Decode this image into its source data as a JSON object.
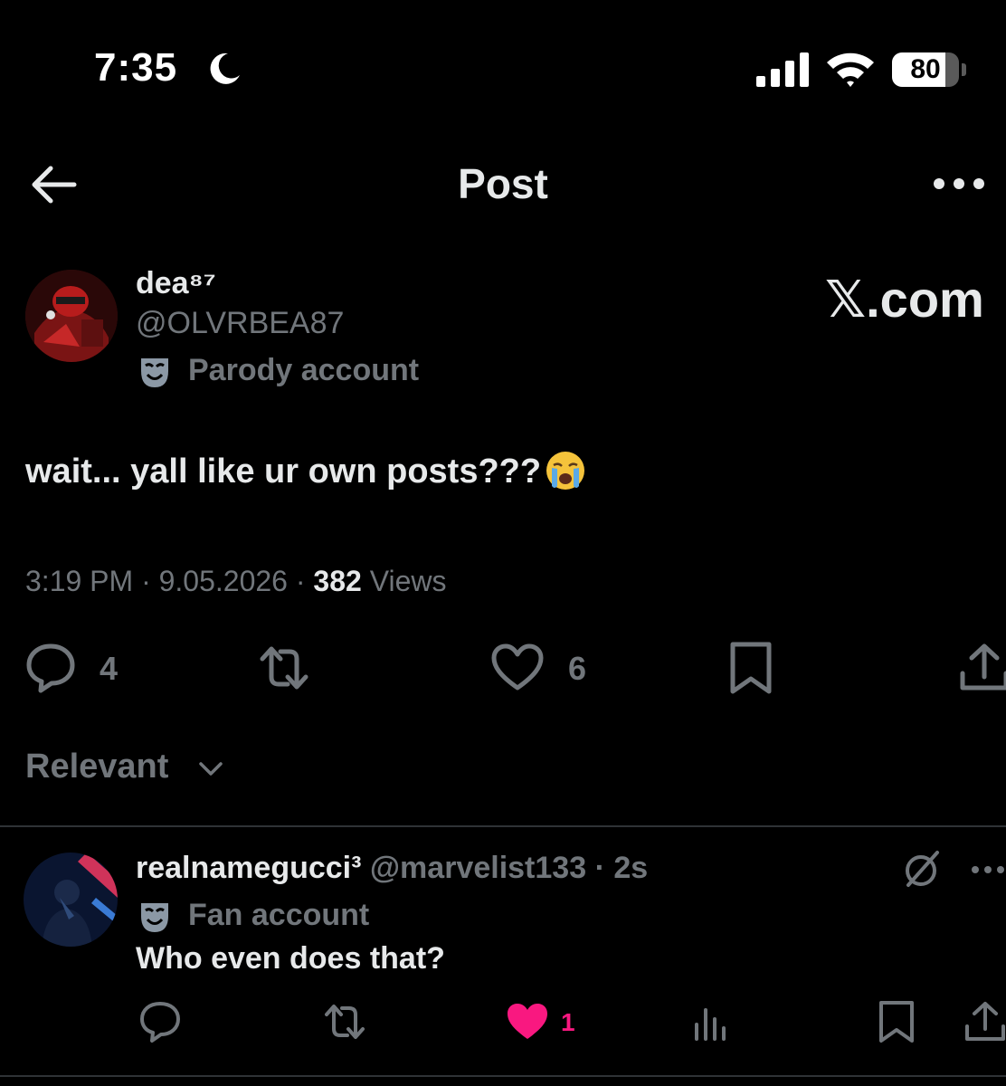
{
  "status_bar": {
    "time": "7:35",
    "battery_level": "80",
    "battery_fraction": 0.8
  },
  "header": {
    "title": "Post"
  },
  "post": {
    "display_name": "dea⁸⁷",
    "handle": "@OLVRBEA87",
    "badge": "Parody account",
    "watermark": "𝕏.com",
    "text": "wait... yall like ur own posts???",
    "timestamp": "3:19 PM",
    "date": "9.05.2026",
    "views_count": "382",
    "views_label": "Views",
    "sep": "·",
    "reply_count": "4",
    "like_count": "6"
  },
  "sort": {
    "label": "Relevant"
  },
  "reply": {
    "display_name": "realnamegucci³",
    "handle": "@marvelist133",
    "sep": "·",
    "time_ago": "2s",
    "badge": "Fan account",
    "text": "Who even does that?",
    "like_count": "1"
  },
  "colors": {
    "background": "#000000",
    "text_primary": "#e7e9ea",
    "text_secondary": "#71767b",
    "like_pink": "#f91880",
    "divider": "#2f3336"
  },
  "icons": [
    "moon-icon",
    "signal-icon",
    "wifi-icon",
    "battery-icon",
    "back-arrow-icon",
    "more-icon",
    "mask-icon",
    "crying-emoji",
    "reply-icon",
    "repost-icon",
    "like-icon",
    "bookmark-icon",
    "share-icon",
    "chevron-down-icon",
    "grok-icon",
    "views-icon"
  ]
}
